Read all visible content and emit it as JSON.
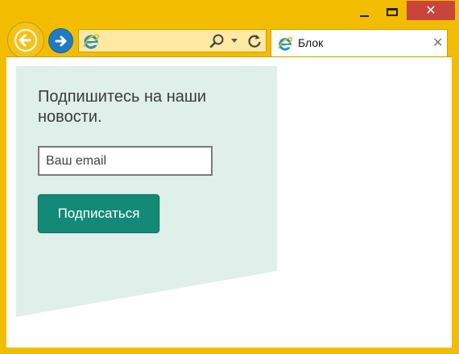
{
  "browser": {
    "tab": {
      "title": "Блок",
      "close_glyph": "✕",
      "icon": "ie-icon"
    },
    "address": {
      "icon": "ie-icon",
      "search_icon": "search-icon",
      "refresh_icon": "refresh-icon"
    },
    "controls": {
      "minimize": "minimize-icon",
      "maximize": "maximize-icon",
      "close_glyph": "✕"
    },
    "colors": {
      "frame": "#f2bd00",
      "address_bg": "#fde9a1",
      "close_btn": "#c9443a",
      "forward_btn": "#1f7ac8"
    }
  },
  "page": {
    "headline": "Подпишитесь на наши новости.",
    "email_placeholder": "Ваш email",
    "subscribe_label": "Подписаться",
    "colors": {
      "panel": "#dfefe9",
      "button": "#138a78"
    }
  }
}
